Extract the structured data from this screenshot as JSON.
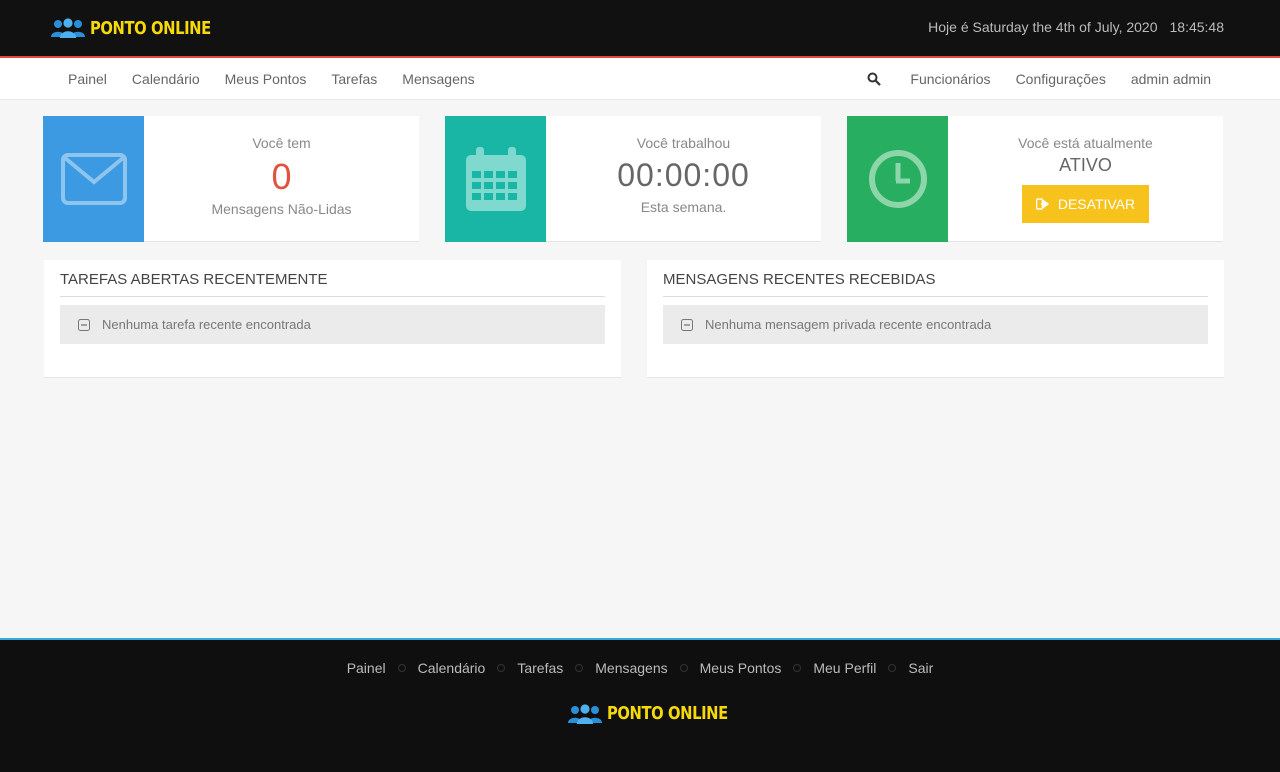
{
  "app": {
    "brand": "PONTO ONLINE",
    "date_text": "Hoje é Saturday the 4th of July, 2020",
    "clock": "18:45:48"
  },
  "nav": {
    "left": [
      "Painel",
      "Calendário",
      "Meus Pontos",
      "Tarefas",
      "Mensagens"
    ],
    "right": [
      "Funcionários",
      "Configurações",
      "admin admin"
    ]
  },
  "cards": {
    "messages": {
      "line1": "Você tem",
      "value": "0",
      "line2": "Mensagens Não-Lidas"
    },
    "hours": {
      "line1": "Você trabalhou",
      "value": "00:00:00",
      "line2": "Esta semana."
    },
    "status": {
      "line1": "Você está atualmente",
      "value": "ATIVO",
      "button": "DESATIVAR"
    }
  },
  "panels": {
    "tasks": {
      "title": "TAREFAS ABERTAS RECENTEMENTE",
      "empty": "Nenhuma tarefa recente encontrada"
    },
    "messages": {
      "title": "MENSAGENS RECENTES RECEBIDAS",
      "empty": "Nenhuma mensagem privada recente encontrada"
    }
  },
  "footer": {
    "links": [
      "Painel",
      "Calendário",
      "Tarefas",
      "Mensagens",
      "Meus Pontos",
      "Meu Perfil",
      "Sair"
    ],
    "brand": "PONTO ONLINE"
  },
  "colors": {
    "header_bg": "#111111",
    "header_accent": "#e04b3c",
    "brand_yellow": "#f5d90a",
    "card_blue": "#3b9ae1",
    "card_teal": "#19b6a5",
    "card_green": "#27ae60",
    "zero_red": "#e0533f",
    "button_yellow": "#f7c21c",
    "footer_accent": "#35a7d8"
  }
}
